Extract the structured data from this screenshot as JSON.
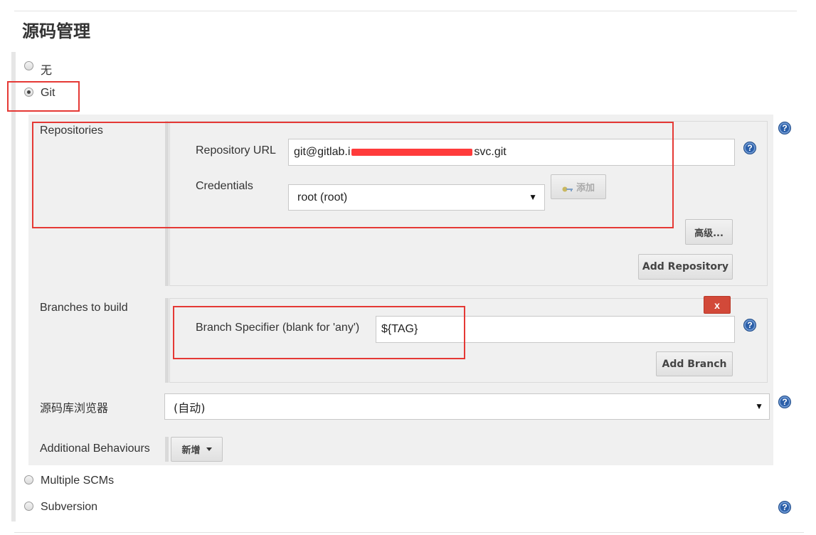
{
  "section": {
    "title": "源码管理"
  },
  "scm_options": {
    "none_label": "无",
    "git_label": "Git",
    "multiple_label": "Multiple SCMs",
    "svn_label": "Subversion"
  },
  "repositories": {
    "label": "Repositories",
    "url_label": "Repository URL",
    "url_value": "git@gitlab.i",
    "url_suffix": "svc.git",
    "credentials_label": "Credentials",
    "credentials_value": "root (root)",
    "add_button": "添加",
    "advanced_button": "高级...",
    "add_repository_button": "Add Repository"
  },
  "branches": {
    "label": "Branches to build",
    "remove_button": "x",
    "specifier_label": "Branch Specifier (blank for 'any')",
    "specifier_value": "${TAG}",
    "add_branch_button": "Add Branch"
  },
  "browser": {
    "label": "源码库浏览器",
    "value": "(自动)"
  },
  "behaviours": {
    "label": "Additional Behaviours",
    "add_button": "新增"
  },
  "icons": {
    "help": "?",
    "dropdown_caret": "▼",
    "key": "key-icon"
  },
  "colors": {
    "highlight_red": "#e53935",
    "help_blue": "#2a5ea8",
    "delete_red": "#d24939"
  }
}
